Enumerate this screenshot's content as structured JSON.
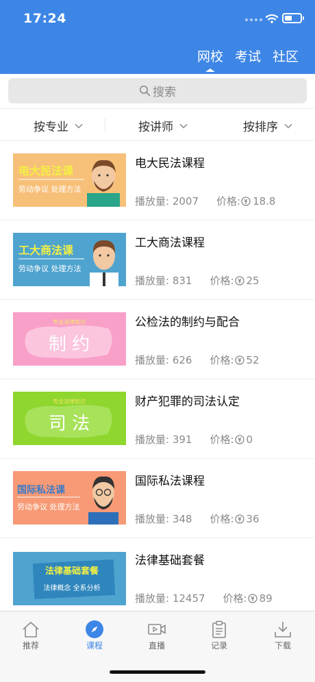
{
  "status": {
    "time": "17:24"
  },
  "header": {
    "tabs": [
      {
        "label": "网校",
        "active": true
      },
      {
        "label": "考试",
        "active": false
      },
      {
        "label": "社区",
        "active": false
      }
    ]
  },
  "search": {
    "placeholder": "搜索"
  },
  "filters": [
    {
      "label": "按专业"
    },
    {
      "label": "按讲师"
    },
    {
      "label": "按排序"
    }
  ],
  "courses": [
    {
      "title": "电大民法课程",
      "plays_label": "播放量: 2007",
      "price_label": "价格:",
      "price": "18.8",
      "thumb_text": "电大民法课",
      "thumb_sub": "劳动争议 处理方法"
    },
    {
      "title": "工大商法课程",
      "plays_label": "播放量: 831",
      "price_label": "价格:",
      "price": "25",
      "thumb_text": "工大商法课",
      "thumb_sub": "劳动争议 处理方法"
    },
    {
      "title": "公检法的制约与配合",
      "plays_label": "播放量: 626",
      "price_label": "价格:",
      "price": "52",
      "thumb_text": "制 约",
      "thumb_sub": "专业法律知识"
    },
    {
      "title": "财产犯罪的司法认定",
      "plays_label": "播放量: 391",
      "price_label": "价格:",
      "price": "0",
      "thumb_text": "司 法",
      "thumb_sub": "专业法律知识"
    },
    {
      "title": "国际私法课程",
      "plays_label": "播放量: 348",
      "price_label": "价格:",
      "price": "36",
      "thumb_text": "国际私法课",
      "thumb_sub": "劳动争议 处理方法"
    },
    {
      "title": "法律基础套餐",
      "plays_label": "播放量: 12457",
      "price_label": "价格:",
      "price": "89",
      "thumb_text": "法律基础套餐",
      "thumb_sub": "法律概念 全系分析"
    }
  ],
  "tabbar": [
    {
      "label": "推荐",
      "icon": "home-icon",
      "active": false
    },
    {
      "label": "课程",
      "icon": "compass-icon",
      "active": true
    },
    {
      "label": "直播",
      "icon": "video-icon",
      "active": false
    },
    {
      "label": "记录",
      "icon": "clipboard-icon",
      "active": false
    },
    {
      "label": "下载",
      "icon": "download-icon",
      "active": false
    }
  ],
  "colors": {
    "brand": "#3d86e6",
    "thumb_bg": [
      "#f7c079",
      "#4fa3cf",
      "#f9a0c8",
      "#8fd62e",
      "#f79a75",
      "#4fa3cf"
    ]
  }
}
